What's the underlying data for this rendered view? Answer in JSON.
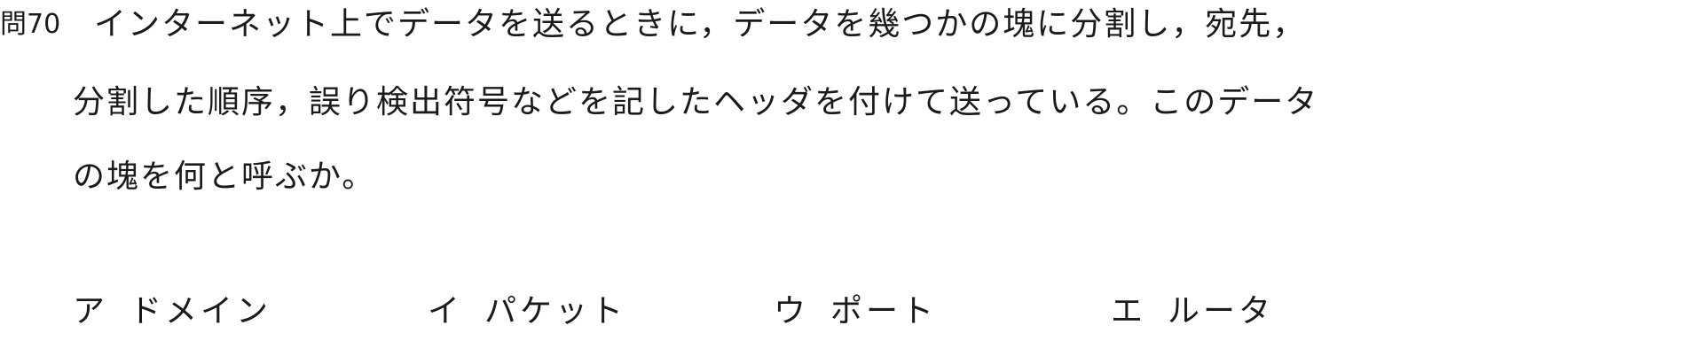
{
  "question": {
    "number": "問70",
    "lines": [
      "インターネット上でデータを送るときに，データを幾つかの塊に分割し，宛先，",
      "分割した順序，誤り検出符号などを記したヘッダを付けて送っている。このデータ",
      "の塊を何と呼ぶか。"
    ]
  },
  "choices": [
    {
      "letter": "ア",
      "text": "ドメイン"
    },
    {
      "letter": "イ",
      "text": "パケット"
    },
    {
      "letter": "ウ",
      "text": "ポート"
    },
    {
      "letter": "エ",
      "text": "ルータ"
    }
  ]
}
